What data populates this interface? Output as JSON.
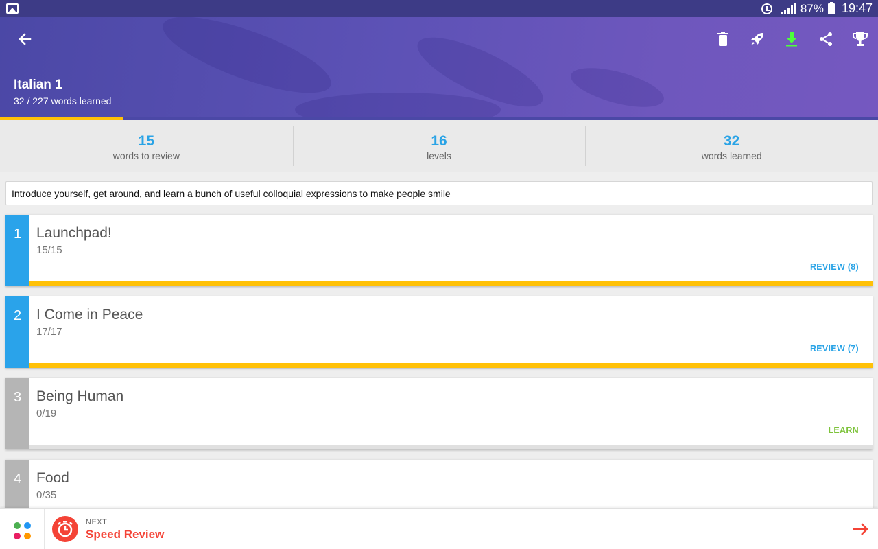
{
  "status_bar": {
    "battery": "87%",
    "time": "19:47",
    "icons": [
      "gallery-icon",
      "alarm-icon",
      "signal-icon",
      "battery-icon"
    ]
  },
  "header": {
    "title": "Italian 1",
    "subtitle": "32 / 227 words learned",
    "progress_fraction": 0.14,
    "toolbar_icons": [
      "delete-icon",
      "rocket-icon",
      "download-icon",
      "share-icon",
      "trophy-icon"
    ],
    "colors": {
      "gradient_start": "#4b48a6",
      "gradient_end": "#7558c0",
      "progress": "#ffc107",
      "download_icon": "#4cff3a"
    }
  },
  "stats": [
    {
      "value": "15",
      "label": "words to review"
    },
    {
      "value": "16",
      "label": "levels"
    },
    {
      "value": "32",
      "label": "words learned"
    }
  ],
  "description": "Introduce yourself, get around, and learn a bunch of useful colloquial expressions to make people smile",
  "levels": [
    {
      "number": "1",
      "name": "Launchpad!",
      "count": "15/15",
      "action": "REVIEW (8)",
      "state": "complete"
    },
    {
      "number": "2",
      "name": "I Come in Peace",
      "count": "17/17",
      "action": "REVIEW (7)",
      "state": "complete"
    },
    {
      "number": "3",
      "name": "Being Human",
      "count": "0/19",
      "action": "LEARN",
      "state": "new"
    },
    {
      "number": "4",
      "name": "Food",
      "count": "0/35",
      "action": "",
      "state": "new"
    }
  ],
  "level_colors": {
    "complete_number_bg": "#2aa3ea",
    "new_number_bg": "#b5b5b5",
    "review_text": "#29a3e6",
    "learn_text": "#7dc33b",
    "complete_bar": "#ffc107",
    "new_bar": "#e0e0e0"
  },
  "bottom_bar": {
    "next_label": "NEXT",
    "next_title": "Speed Review",
    "dot_colors": [
      "#4caf50",
      "#2196f3",
      "#e91e63",
      "#ff9800"
    ],
    "accent": "#f44336"
  }
}
